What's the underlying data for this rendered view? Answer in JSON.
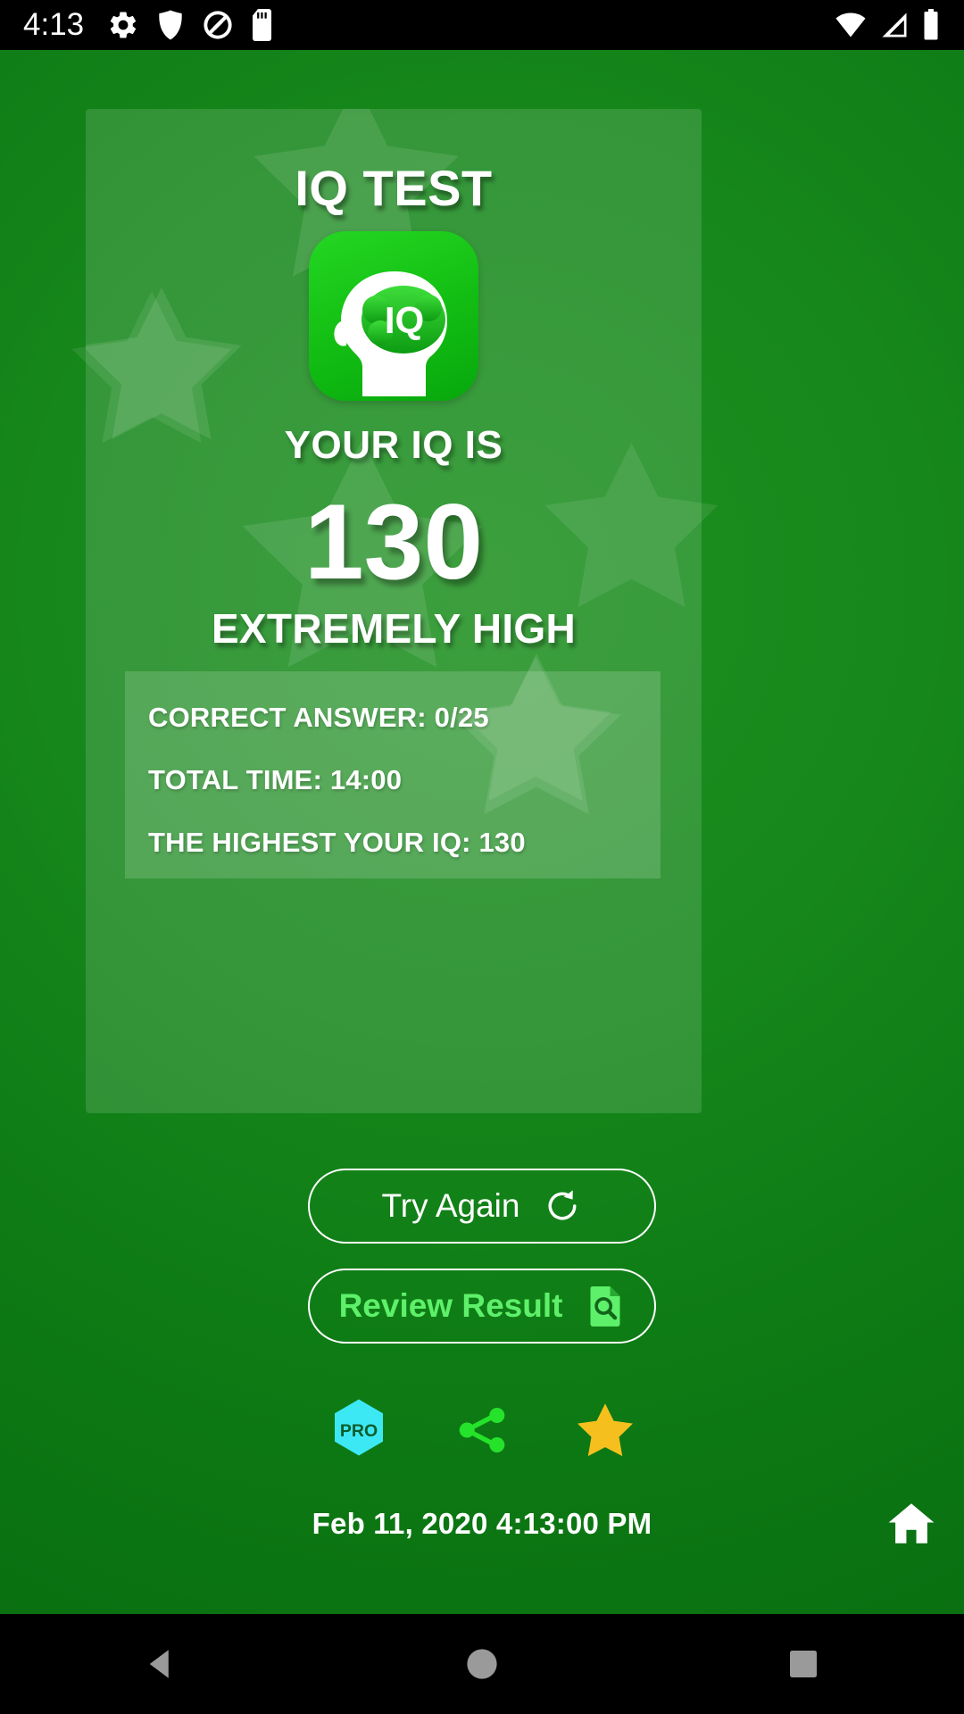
{
  "status_bar": {
    "time": "4:13",
    "left_icons": [
      "gear-icon",
      "shield-icon",
      "do-not-disturb-icon",
      "sd-card-icon"
    ],
    "right_icons": [
      "wifi-icon",
      "cellular-signal-icon",
      "battery-icon"
    ]
  },
  "card": {
    "title": "IQ TEST",
    "app_icon_label": "IQ",
    "your_iq_label": "YOUR IQ IS",
    "score": "130",
    "rating": "EXTREMELY HIGH",
    "stats": [
      "CORRECT ANSWER: 0/25",
      "TOTAL TIME: 14:00",
      "THE HIGHEST YOUR IQ: 130"
    ]
  },
  "buttons": {
    "try_again": {
      "label": "Try Again",
      "icon": "refresh-icon"
    },
    "review_result": {
      "label": "Review Result",
      "icon": "document-search-icon"
    }
  },
  "actions": [
    {
      "name": "pro-badge-button",
      "icon": "pro-hexagon-icon",
      "label": "PRO"
    },
    {
      "name": "share-button",
      "icon": "share-icon"
    },
    {
      "name": "rate-star-button",
      "icon": "star-icon"
    }
  ],
  "footer": {
    "timestamp": "Feb 11, 2020 4:13:00 PM",
    "home_icon": "home-icon"
  },
  "nav_bar": {
    "back": "back-triangle-icon",
    "home": "home-circle-icon",
    "recents": "recents-square-icon"
  },
  "colors": {
    "background_green": "#0d7a14",
    "accent_light_green": "#5ef06a",
    "pro_cyan": "#3de8f5",
    "share_green": "#25e22a",
    "star_gold": "#f5c01e",
    "text_white": "#ffffff"
  }
}
